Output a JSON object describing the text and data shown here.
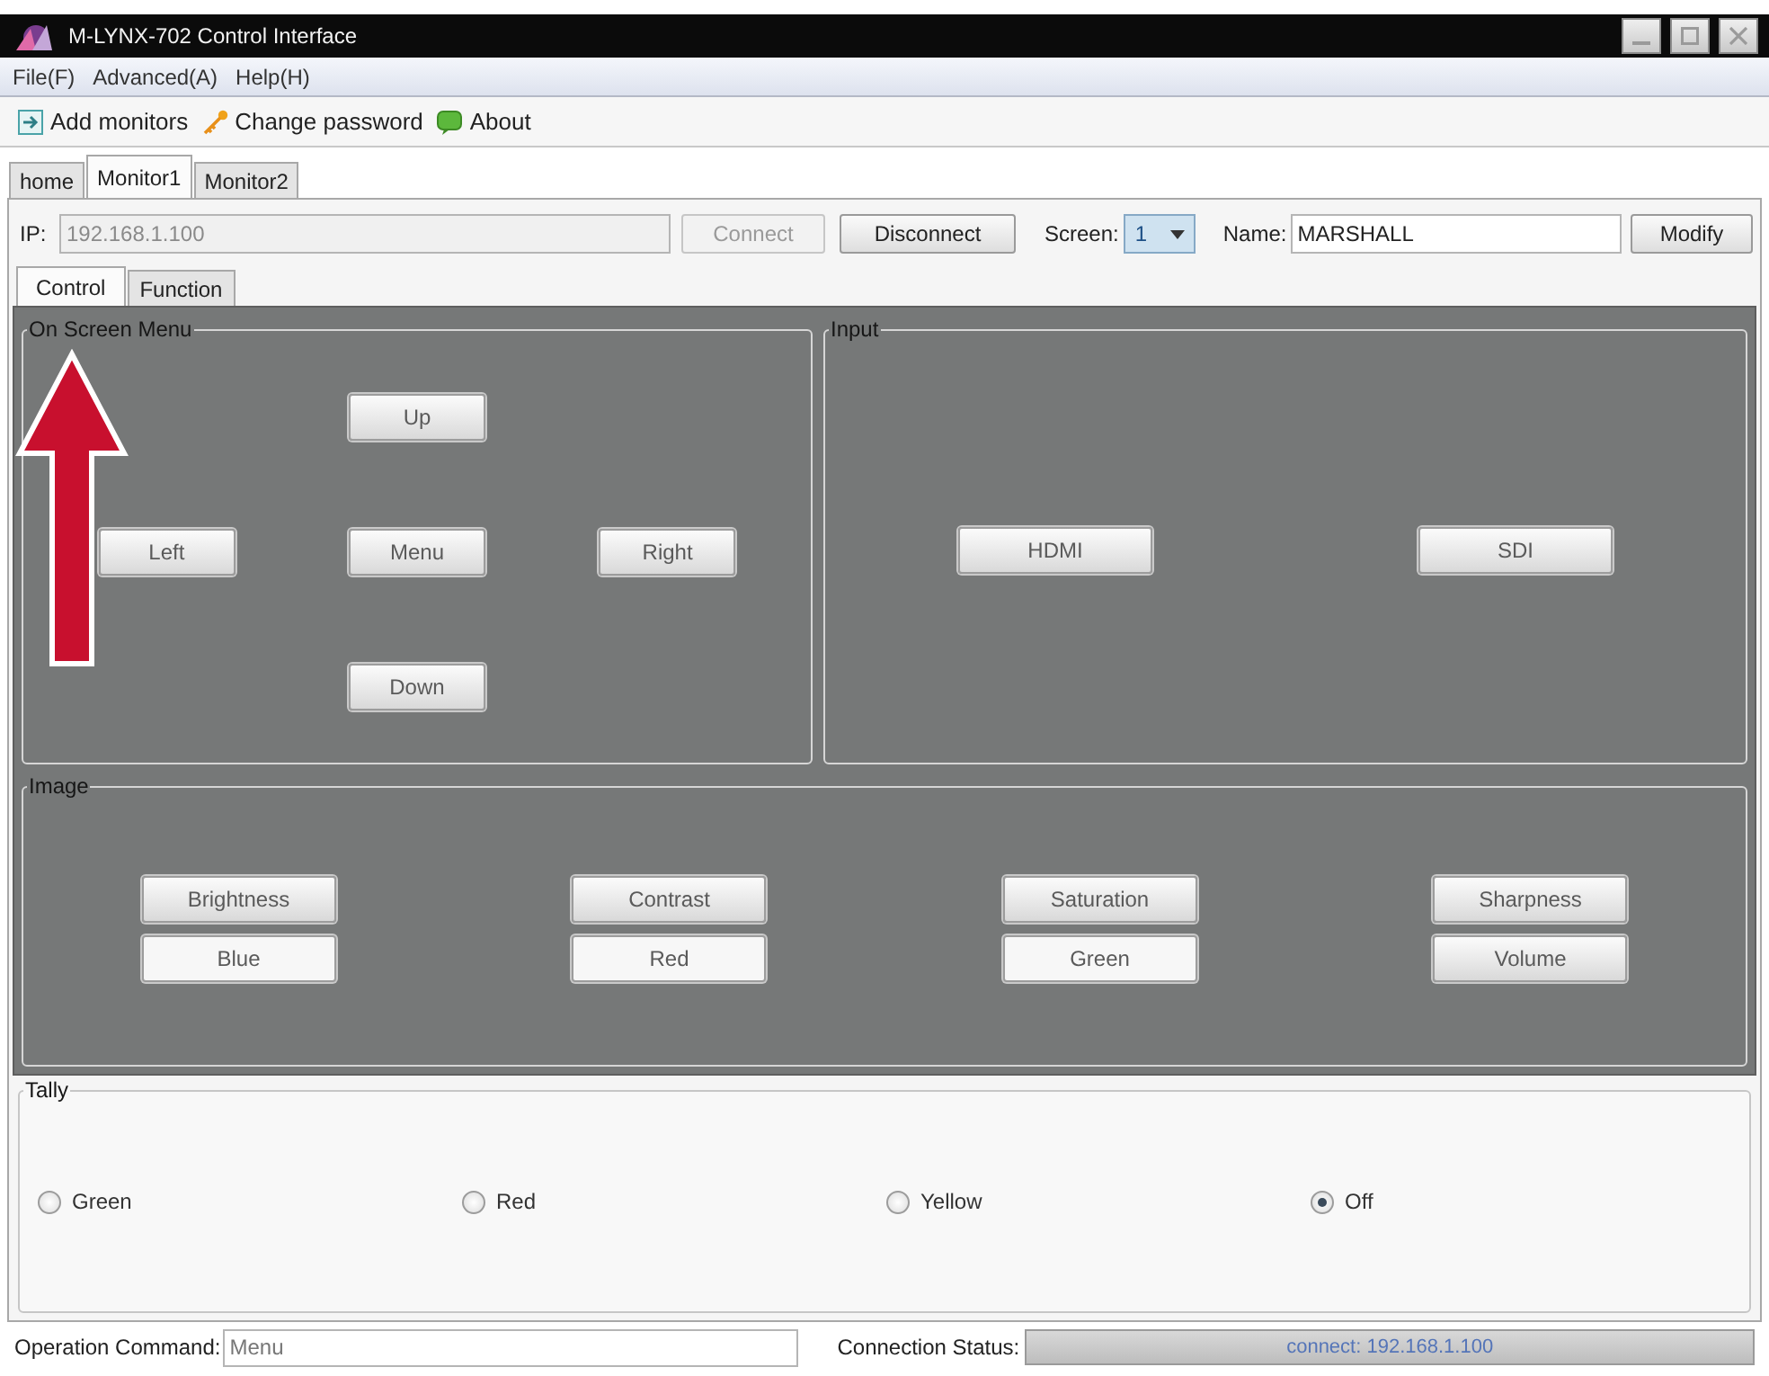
{
  "window": {
    "title": "M-LYNX-702 Control Interface"
  },
  "menu_bar": [
    "File(F)",
    "Advanced(A)",
    "Help(H)"
  ],
  "toolbar": [
    "Add monitors",
    "Change password",
    "About"
  ],
  "monitor_tabs": [
    {
      "label": "home",
      "selected": false
    },
    {
      "label": "Monitor1",
      "selected": true
    },
    {
      "label": "Monitor2",
      "selected": false
    }
  ],
  "connection": {
    "ip_label": "IP:",
    "ip": {
      "value": "192.168.1.100",
      "disabled": true
    },
    "connect": {
      "label": "Connect",
      "disabled": true
    },
    "disconnect": {
      "label": "Disconnect",
      "disabled": false
    },
    "screen_label": "Screen:",
    "screen": "1",
    "name_label": "Name:",
    "name": "MARSHALL",
    "modify": "Modify"
  },
  "sub_tabs": [
    {
      "label": "Control",
      "selected": true
    },
    {
      "label": "Function",
      "selected": false
    }
  ],
  "on_screen_menu": {
    "title": "On Screen Menu",
    "buttons": [
      "Up",
      "Left",
      "Menu",
      "Right",
      "Down"
    ]
  },
  "input": {
    "title": "Input",
    "buttons": [
      "HDMI",
      "SDI"
    ]
  },
  "image": {
    "title": "Image",
    "buttons": [
      {
        "label": "Brightness",
        "kind": "raised"
      },
      {
        "label": "Contrast",
        "kind": "raised"
      },
      {
        "label": "Saturation",
        "kind": "raised"
      },
      {
        "label": "Sharpness",
        "kind": "raised"
      },
      {
        "label": "Blue",
        "kind": "flat"
      },
      {
        "label": "Red",
        "kind": "flat"
      },
      {
        "label": "Green",
        "kind": "flat"
      },
      {
        "label": "Volume",
        "kind": "raised"
      }
    ]
  },
  "tally": {
    "title": "Tally",
    "options": [
      {
        "label": "Green",
        "selected": false
      },
      {
        "label": "Red",
        "selected": false
      },
      {
        "label": "Yellow",
        "selected": false
      },
      {
        "label": "Off",
        "selected": true
      }
    ]
  },
  "status_bar": {
    "command_label": "Operation Command:",
    "command": "Menu",
    "status_label": "Connection Status:",
    "status": "connect: 192.168.1.100"
  }
}
